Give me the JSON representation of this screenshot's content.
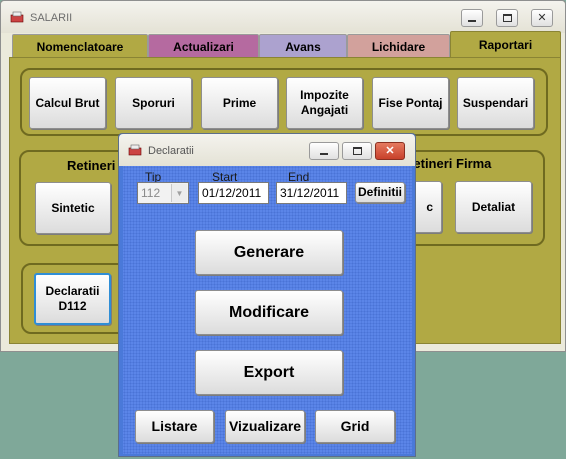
{
  "main_window": {
    "title": "SALARII",
    "tabs": [
      {
        "label": "Nomenclatoare",
        "color": "#b1a944"
      },
      {
        "label": "Actualizari",
        "color": "#b56aa0"
      },
      {
        "label": "Avans",
        "color": "#aca2cf"
      },
      {
        "label": "Lichidare",
        "color": "#d2a19c"
      },
      {
        "label": "Raportari",
        "color": "#b1a944"
      }
    ],
    "active_tab": "Raportari",
    "top_buttons": [
      "Calcul Brut",
      "Sporuri",
      "Prime",
      "Impozite Angajati",
      "Fise Pontaj",
      "Suspendari"
    ],
    "retineri_group": {
      "label": "Retineri",
      "buttons": [
        "Sintetic"
      ]
    },
    "retineri_firma_group": {
      "label": "Retineri Firma",
      "buttons": [
        "c",
        "Detaliat"
      ]
    },
    "declaratii_button": "Declaratii D112"
  },
  "dialog": {
    "title": "Declaratii",
    "tip_label": "Tip",
    "start_label": "Start",
    "end_label": "End",
    "tip_value": "112",
    "start_value": "01/12/2011",
    "end_value": "31/12/2011",
    "definitii_button": "Definitii",
    "main_buttons": [
      "Generare",
      "Modificare",
      "Export"
    ],
    "bottom_buttons": [
      "Listare",
      "Vizualizare",
      "Grid"
    ]
  },
  "colors": {
    "desktop": "#7fa899",
    "panel": "#b1a944",
    "dialog_body": "#5b85e8",
    "close_button": "#d8553c"
  }
}
